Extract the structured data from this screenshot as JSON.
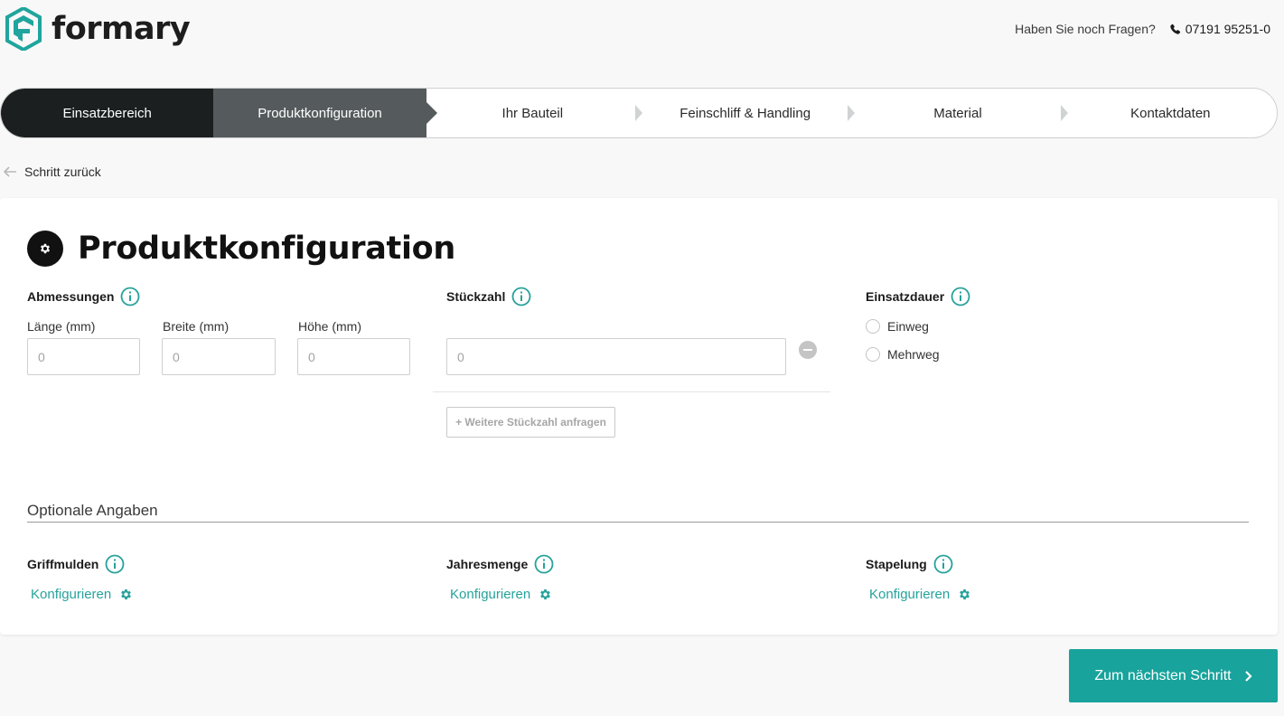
{
  "brand": {
    "name": "formary",
    "accent": "#18a39c"
  },
  "header": {
    "question": "Haben Sie noch Fragen?",
    "phone": "07191 95251-0"
  },
  "steps": [
    {
      "label": "Einsatzbereich",
      "state": "done"
    },
    {
      "label": "Produktkonfiguration",
      "state": "active"
    },
    {
      "label": "Ihr Bauteil",
      "state": "upcoming"
    },
    {
      "label": "Feinschliff & Handling",
      "state": "upcoming"
    },
    {
      "label": "Material",
      "state": "upcoming"
    },
    {
      "label": "Kontaktdaten",
      "state": "upcoming"
    }
  ],
  "back_label": "Schritt zurück",
  "page": {
    "title": "Produktkonfiguration",
    "dimensions": {
      "label": "Abmessungen",
      "fields": [
        {
          "label": "Länge (mm)",
          "placeholder": "0",
          "value": ""
        },
        {
          "label": "Breite (mm)",
          "placeholder": "0",
          "value": ""
        },
        {
          "label": "Höhe (mm)",
          "placeholder": "0",
          "value": ""
        }
      ]
    },
    "quantity": {
      "label": "Stückzahl",
      "placeholder": "0",
      "value": "",
      "add_button": "+ Weitere Stückzahl anfragen"
    },
    "duration": {
      "label": "Einsatzdauer",
      "options": [
        "Einweg",
        "Mehrweg"
      ],
      "selected": null
    },
    "optional": {
      "title": "Optionale Angaben",
      "items": [
        {
          "label": "Griffmulden",
          "action": "Konfigurieren"
        },
        {
          "label": "Jahresmenge",
          "action": "Konfigurieren"
        },
        {
          "label": "Stapelung",
          "action": "Konfigurieren"
        }
      ]
    }
  },
  "next_button": "Zum nächsten Schritt"
}
